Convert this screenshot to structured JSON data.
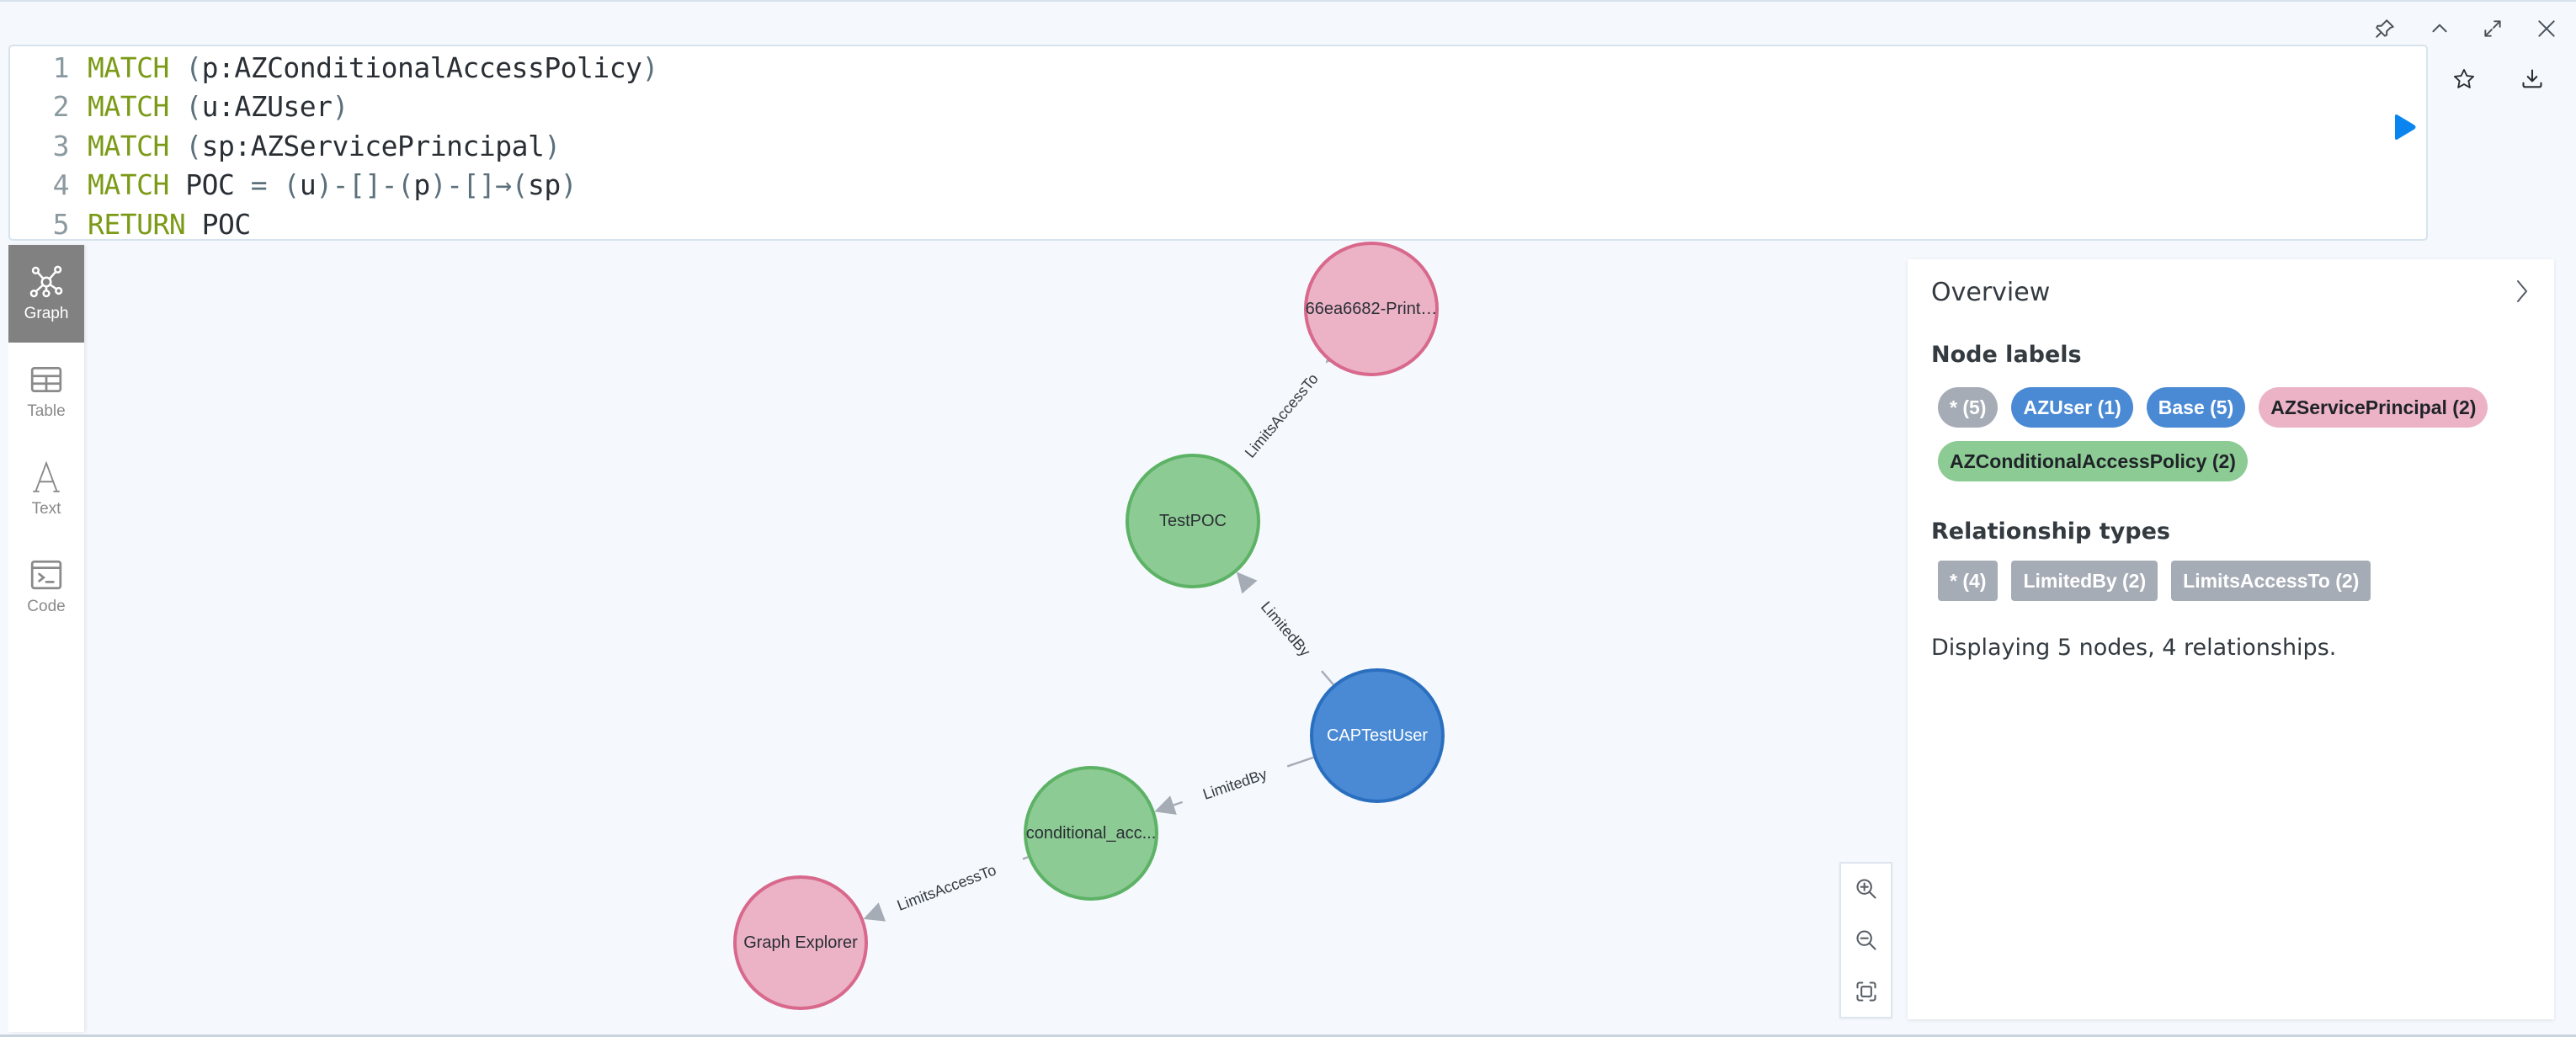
{
  "window_controls": {
    "pin": "pin-icon",
    "collapse": "chevron-up-icon",
    "expand": "expand-icon",
    "close": "close-icon"
  },
  "editor": {
    "lines": [
      {
        "no": "1",
        "tokens": [
          {
            "t": "kw",
            "v": "MATCH"
          },
          {
            "t": "sp",
            "v": " "
          },
          {
            "t": "punc",
            "v": "("
          },
          {
            "t": "id",
            "v": "p:AZConditionalAccessPolicy"
          },
          {
            "t": "punc",
            "v": ")"
          }
        ]
      },
      {
        "no": "2",
        "tokens": [
          {
            "t": "kw",
            "v": "MATCH"
          },
          {
            "t": "sp",
            "v": " "
          },
          {
            "t": "punc",
            "v": "("
          },
          {
            "t": "id",
            "v": "u:AZUser"
          },
          {
            "t": "punc",
            "v": ")"
          }
        ]
      },
      {
        "no": "3",
        "tokens": [
          {
            "t": "kw",
            "v": "MATCH"
          },
          {
            "t": "sp",
            "v": " "
          },
          {
            "t": "punc",
            "v": "("
          },
          {
            "t": "id",
            "v": "sp:AZServicePrincipal"
          },
          {
            "t": "punc",
            "v": ")"
          }
        ]
      },
      {
        "no": "4",
        "tokens": [
          {
            "t": "kw",
            "v": "MATCH"
          },
          {
            "t": "sp",
            "v": " "
          },
          {
            "t": "id",
            "v": "POC"
          },
          {
            "t": "sp",
            "v": " "
          },
          {
            "t": "punc",
            "v": "="
          },
          {
            "t": "sp",
            "v": " "
          },
          {
            "t": "punc",
            "v": "("
          },
          {
            "t": "id",
            "v": "u"
          },
          {
            "t": "punc",
            "v": ")-[]-("
          },
          {
            "t": "id",
            "v": "p"
          },
          {
            "t": "punc",
            "v": ")-[]→("
          },
          {
            "t": "id",
            "v": "sp"
          },
          {
            "t": "punc",
            "v": ")"
          }
        ]
      },
      {
        "no": "5",
        "tokens": [
          {
            "t": "kw",
            "v": "RETURN"
          },
          {
            "t": "sp",
            "v": " "
          },
          {
            "t": "id",
            "v": "POC"
          }
        ]
      }
    ],
    "run_icon": "play-icon",
    "favorite_icon": "star-icon",
    "download_icon": "download-icon"
  },
  "sidebar": {
    "tabs": [
      {
        "label": "Graph",
        "icon": "graph-icon",
        "active": true
      },
      {
        "label": "Table",
        "icon": "table-icon",
        "active": false
      },
      {
        "label": "Text",
        "icon": "text-icon",
        "active": false
      },
      {
        "label": "Code",
        "icon": "code-icon",
        "active": false
      }
    ]
  },
  "graph": {
    "nodes": [
      {
        "id": "sp1",
        "label": "66ea6682-Print…",
        "type": "AZServicePrincipal"
      },
      {
        "id": "cap1",
        "label": "TestPOC",
        "type": "AZConditionalAccessPolicy"
      },
      {
        "id": "user",
        "label": "CAPTestUser",
        "type": "AZUser"
      },
      {
        "id": "cap2",
        "label": "conditional_acc...",
        "type": "AZConditionalAccessPolicy"
      },
      {
        "id": "sp2",
        "label": "Graph Explorer",
        "type": "AZServicePrincipal"
      }
    ],
    "edges": [
      {
        "from": "cap1",
        "to": "sp1",
        "label": "LimitsAccessTo"
      },
      {
        "from": "user",
        "to": "cap1",
        "label": "LimitedBy"
      },
      {
        "from": "user",
        "to": "cap2",
        "label": "LimitedBy"
      },
      {
        "from": "cap2",
        "to": "sp2",
        "label": "LimitsAccessTo"
      }
    ],
    "zoom_controls": [
      "zoom-in-icon",
      "zoom-out-icon",
      "fit-to-screen-icon"
    ]
  },
  "colors": {
    "AZUser": {
      "fill": "#4a8ad4",
      "stroke": "#2a6fbf",
      "text": "#ffffff"
    },
    "AZConditionalAccessPolicy": {
      "fill": "#8dcb94",
      "stroke": "#5db266",
      "text": "#2a2f35"
    },
    "AZServicePrincipal": {
      "fill": "#ebb3c5",
      "stroke": "#d8698c",
      "text": "#2a2f35"
    },
    "wildcard": {
      "fill": "#a6acb6",
      "text": "#ffffff"
    },
    "relationship": {
      "fill": "#a6acb6",
      "text": "#ffffff"
    },
    "edge": "#a6acb6",
    "run": "#0a85f0"
  },
  "overview": {
    "title": "Overview",
    "node_labels_heading": "Node labels",
    "node_labels": [
      {
        "label": "* (5)",
        "style": "wildcard"
      },
      {
        "label": "AZUser (1)",
        "style": "AZUser"
      },
      {
        "label": "Base (5)",
        "style": "AZUser"
      },
      {
        "label": "AZServicePrincipal (2)",
        "style": "AZServicePrincipal"
      },
      {
        "label": "AZConditionalAccessPolicy (2)",
        "style": "AZConditionalAccessPolicy"
      }
    ],
    "relationship_types_heading": "Relationship types",
    "relationship_types": [
      {
        "label": "* (4)"
      },
      {
        "label": "LimitedBy (2)"
      },
      {
        "label": "LimitsAccessTo (2)"
      }
    ],
    "status": "Displaying 5 nodes, 4 relationships."
  }
}
